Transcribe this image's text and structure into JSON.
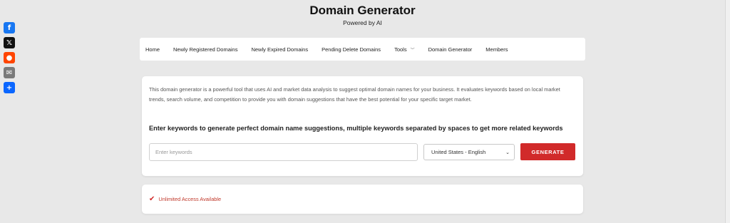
{
  "site": {
    "title": "Domain Generator",
    "subtitle": "Powered by AI"
  },
  "share": [
    {
      "name": "facebook",
      "glyph": "f",
      "color": "#1877f2"
    },
    {
      "name": "x",
      "glyph": "𝕏",
      "color": "#111111"
    },
    {
      "name": "reddit",
      "glyph": "●",
      "color": "#ff4500"
    },
    {
      "name": "email",
      "glyph": "✉",
      "color": "#7a7a7a"
    },
    {
      "name": "share",
      "glyph": "+",
      "color": "#0a66ff"
    }
  ],
  "nav": {
    "items": [
      {
        "label": "Home"
      },
      {
        "label": "Newly Registered Domains"
      },
      {
        "label": "Newly Expired Domains"
      },
      {
        "label": "Pending Delete Domains"
      },
      {
        "label": "Tools",
        "has_dropdown": true
      },
      {
        "label": "Domain Generator"
      },
      {
        "label": "Members"
      }
    ]
  },
  "generator": {
    "description": "This domain generator is a powerful tool that uses AI and market data analysis to suggest optimal domain names for your business. It evaluates keywords based on local market trends, search volume, and competition to provide you with domain suggestions that have the best potential for your specific target market.",
    "heading": "Enter keywords to generate perfect domain name suggestions, multiple keywords separated by spaces to get more related keywords",
    "input_value": "",
    "input_placeholder": "Enter keywords",
    "locale_selected": "United States - English",
    "button_label": "GENERATE"
  },
  "access": {
    "label": "Unlimited Access Available"
  },
  "colors": {
    "accent": "#d12a2a",
    "background": "#e8e8e8"
  }
}
